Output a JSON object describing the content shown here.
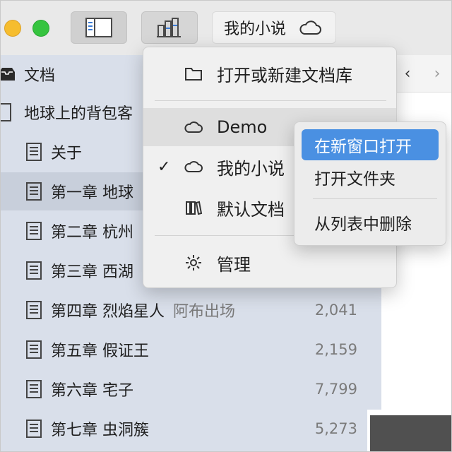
{
  "toolbar": {
    "library_name": "我的小说"
  },
  "sidebar": {
    "section_label": "文档",
    "book_title": "地球上的背包客",
    "chapters": [
      {
        "title": "关于",
        "subtitle": "",
        "count": ""
      },
      {
        "title": "第一章 地球",
        "subtitle": "",
        "count": ""
      },
      {
        "title": "第二章 杭州",
        "subtitle": "",
        "count": ""
      },
      {
        "title": "第三章 西湖",
        "subtitle": "",
        "count": ""
      },
      {
        "title": "第四章 烈焰星人",
        "subtitle": "阿布出场",
        "count": "2,041"
      },
      {
        "title": "第五章 假证王",
        "subtitle": "",
        "count": "2,159"
      },
      {
        "title": "第六章 宅子",
        "subtitle": "",
        "count": "7,799"
      },
      {
        "title": "第七章 虫洞簇",
        "subtitle": "",
        "count": "5,273"
      }
    ]
  },
  "nav": {
    "back": "‹",
    "forward": "›"
  },
  "menu": {
    "items": [
      {
        "label": "打开或新建文档库"
      },
      {
        "label": "Demo"
      },
      {
        "label": "我的小说"
      },
      {
        "label": "默认文档"
      },
      {
        "label": "管理"
      }
    ],
    "check_mark": "✓"
  },
  "submenu": {
    "items": [
      {
        "label": "在新窗口打开"
      },
      {
        "label": "打开文件夹"
      },
      {
        "label": "从列表中删除"
      }
    ]
  },
  "colors": {
    "highlight": "#4a90e2",
    "sidebar_bg": "#d9dfea"
  }
}
